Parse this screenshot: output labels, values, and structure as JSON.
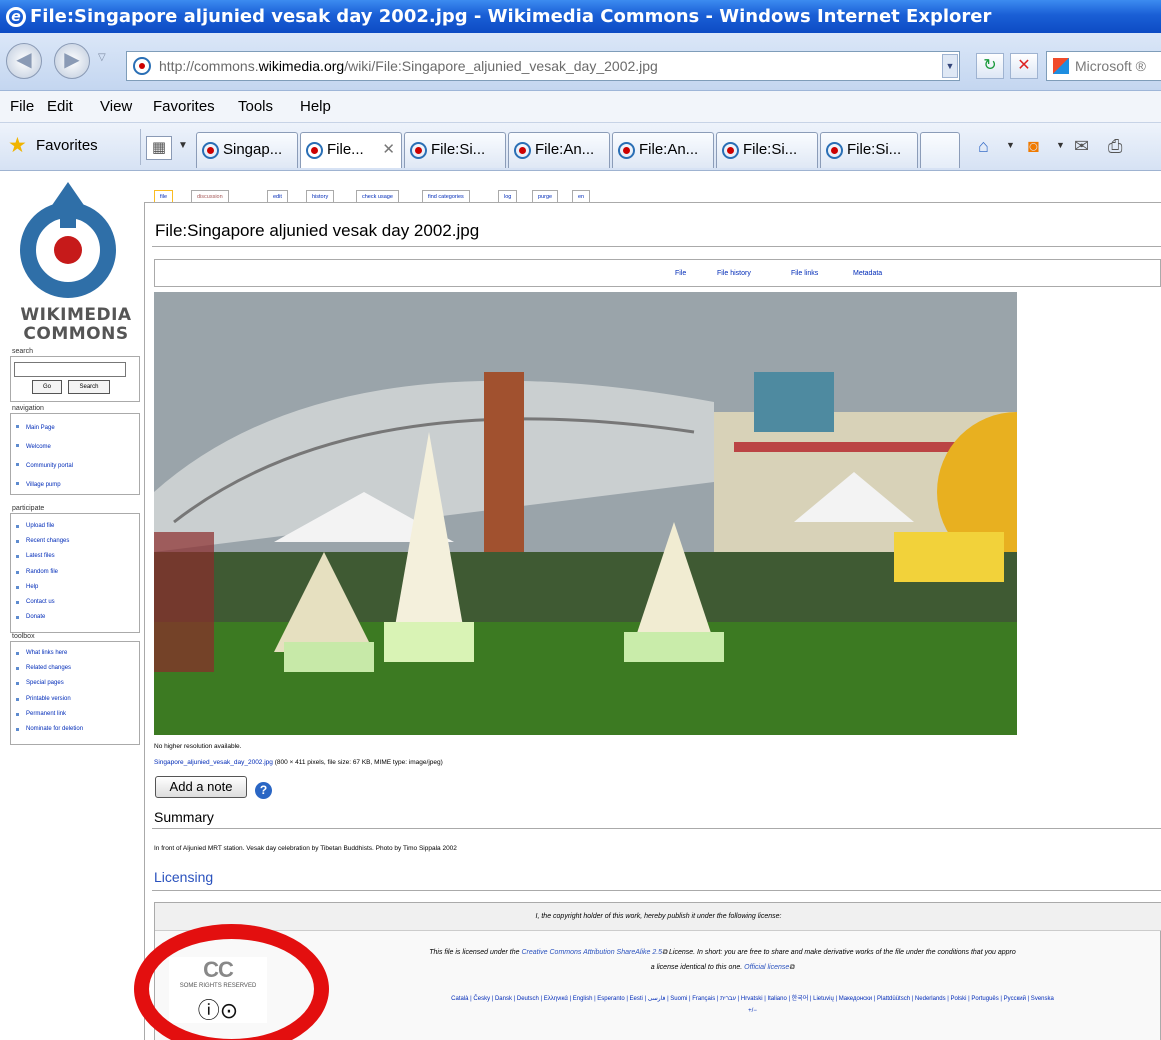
{
  "window": {
    "title": "File:Singapore aljunied vesak day 2002.jpg - Wikimedia Commons - Windows Internet Explorer"
  },
  "address": {
    "url_prefix": "http://commons.",
    "url_domain": "wikimedia.org",
    "url_suffix": "/wiki/File:Singapore_aljunied_vesak_day_2002.jpg",
    "search_placeholder": "Microsoft ®"
  },
  "menu": [
    "File",
    "Edit",
    "View",
    "Favorites",
    "Tools",
    "Help"
  ],
  "favorites": {
    "label": "Favorites"
  },
  "tabs": [
    {
      "label": "Singap..."
    },
    {
      "label": "File..."
    },
    {
      "label": "File:Si..."
    },
    {
      "label": "File:An..."
    },
    {
      "label": "File:An..."
    },
    {
      "label": "File:Si..."
    },
    {
      "label": "File:Si..."
    }
  ],
  "sidebar": {
    "logo_line1": "WIKIMEDIA",
    "logo_line2": "COMMONS",
    "search_header": "search",
    "go_label": "Go",
    "search_label": "Search",
    "navigation_header": "navigation",
    "navigation": [
      "Main Page",
      "Welcome",
      "Community portal",
      "Village pump"
    ],
    "participate_header": "participate",
    "participate": [
      "Upload file",
      "Recent changes",
      "Latest files",
      "Random file",
      "Help",
      "Contact us",
      "Donate"
    ],
    "toolbox_header": "toolbox",
    "toolbox": [
      "What links here",
      "Related changes",
      "Special pages",
      "Printable version",
      "Permanent link",
      "Nominate for deletion"
    ]
  },
  "content_tabs": [
    "file",
    "discussion",
    "edit",
    "history",
    "check usage",
    "find categories",
    "log",
    "purge",
    "en"
  ],
  "page": {
    "title": "File:Singapore aljunied vesak day 2002.jpg",
    "toc": [
      "File",
      "File history",
      "File links",
      "Metadata"
    ],
    "no_higher": "No higher resolution available.",
    "file_link": "Singapore_aljunied_vesak_day_2002.jpg",
    "file_info": " (800 × 411 pixels, file size: 67 KB, MIME type: image/jpeg)",
    "add_note": "Add a note",
    "summary_heading": "Summary",
    "summary_text": "In front of Aljunied MRT station. Vesak day celebration by Tibetan Buddhists. Photo by Timo Sippala 2002",
    "licensing_heading": "Licensing",
    "license_header": "I, the copyright holder of this work, hereby publish it under the following license:",
    "license_line1_a": "This file is licensed under the ",
    "license_link": "Creative Commons Attribution ShareAlike 2.5",
    "license_line1_b": " License. In short: you are free to share and make derivative works of the file under the conditions that you appro",
    "license_line2_a": "a license identical to this one. ",
    "official_link": "Official license",
    "languages": "Català | Česky | Dansk | Deutsch | Ελληνικά | English | Esperanto | Eesti | فارسی | Suomi | Français | עברית | Hrvatski | Italiano | 한국어 | Lietuvių | Македонски | Plattdüütsch | Nederlands | Polski | Português | Русский | Svenska",
    "lang_more": "+/−",
    "cc_logo": "CC",
    "cc_sub": "SOME RIGHTS RESERVED"
  }
}
